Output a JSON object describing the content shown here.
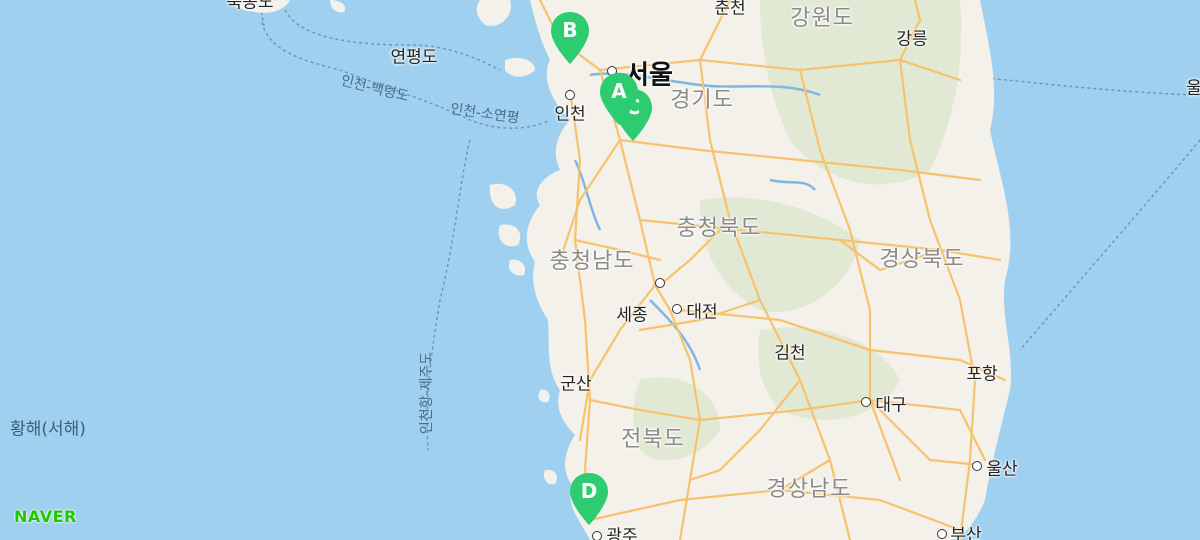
{
  "map": {
    "provider_logo": "NAVER",
    "colors": {
      "sea": "#9fd0f0",
      "land": "#f4f1ea",
      "road": "#f6c26b",
      "marker": "#2ecc71",
      "river": "#7fb6e6"
    },
    "labels": {
      "buk": "북동도",
      "chuncheon": "춘천",
      "gangwon": "강원도",
      "yeonpyeong": "연평도",
      "gangneung": "강릉",
      "seoul": "서울",
      "gyeonggi": "경기도",
      "incheon_baengnyeong": "인천-백령도",
      "incheon_soyeonpyeong": "인천-소연평",
      "incheon": "인천",
      "chungbuk": "충청북도",
      "chungnam": "충청남도",
      "gyeongbuk": "경상북도",
      "sejong": "세종",
      "daejeon": "대전",
      "gimcheon": "김천",
      "gunsan": "군산",
      "pohang": "포항",
      "incheon_jeju": "인천항-제주도",
      "yellow_sea": "황해(서해)",
      "daegu": "대구",
      "jeonbuk": "전북도",
      "ulsan": "울산",
      "gyeongnam": "경상남도",
      "gwangju": "광주",
      "busan": "부산",
      "ul": "울"
    },
    "markers": [
      {
        "id": "A",
        "label": "A"
      },
      {
        "id": "C",
        "label": "C"
      },
      {
        "id": "B",
        "label": "B"
      },
      {
        "id": "D",
        "label": "D"
      }
    ]
  }
}
